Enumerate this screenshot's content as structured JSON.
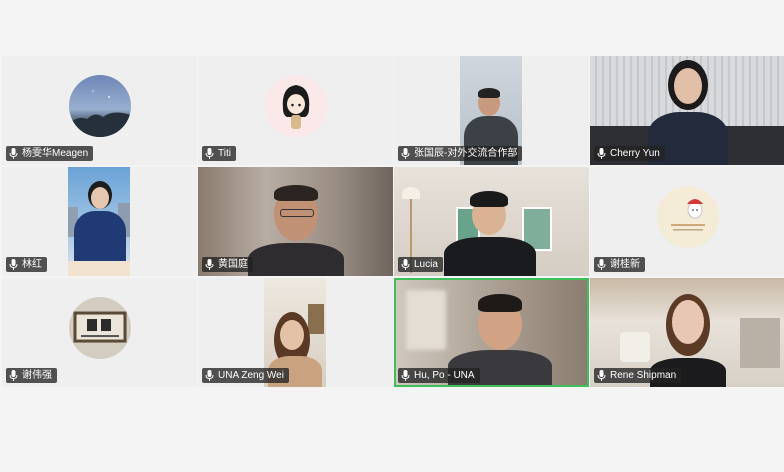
{
  "participants": [
    {
      "name": "杨雯华Meagen"
    },
    {
      "name": "Titi"
    },
    {
      "name": "张国辰-对外交流合作部"
    },
    {
      "name": "Cherry Yun"
    },
    {
      "name": "林红"
    },
    {
      "name": "黄国庭"
    },
    {
      "name": "Lucia"
    },
    {
      "name": "谢桂新"
    },
    {
      "name": "谢伟强"
    },
    {
      "name": "UNA Zeng Wei"
    },
    {
      "name": "Hu, Po - UNA"
    },
    {
      "name": "Rene Shipman"
    }
  ],
  "colors": {
    "name_tag_bg": "#232323",
    "active_speaker_border": "#3fbf5a",
    "tile_bg": "#efefef",
    "page_bg": "#f4f4f4"
  },
  "icons": {
    "mic": "microphone-icon"
  }
}
